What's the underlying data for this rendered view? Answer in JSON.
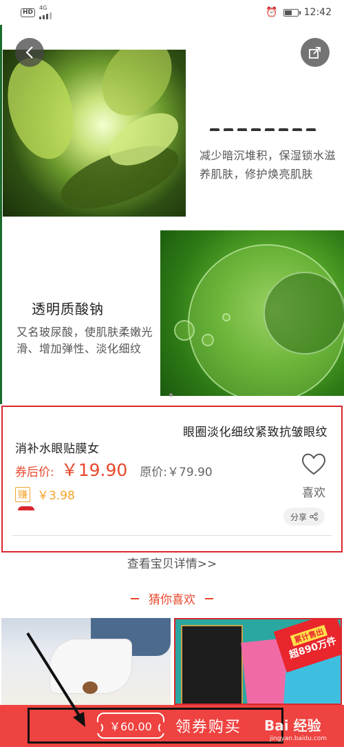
{
  "status_bar": {
    "hd_label": "HD",
    "network_type": "4G",
    "time": "12:42",
    "battery_level": 0.6
  },
  "product_images": {
    "right_description": "减少暗沉堆积，保湿锁水滋养肌肤，修护焕亮肌肤",
    "feature_title": "透明质酸钠",
    "feature_description": "又名玻尿酸，使肌肤柔嫩光滑、增加弹性、淡化细纹",
    "carousel_total": 2,
    "carousel_active": 1
  },
  "product": {
    "title_line1": "眼圈淡化细纹紧致抗皱眼纹",
    "title_line2": "消补水眼贴膜女",
    "price_label": "券后价:",
    "price": "￥19.90",
    "original_price": "原价:￥79.90",
    "earn_badge": "赚",
    "earn_amount": "￥3.98",
    "like_label": "喜欢",
    "share_label": "分享"
  },
  "view_details": "查看宝贝详情>>",
  "guess_you_like": "猜你喜欢",
  "recommendations": {
    "right_badge_top": "累计售出",
    "right_badge_main": "超890万件"
  },
  "bottom_bar": {
    "coupon_value": "￥60.00",
    "claim_label": "领券购买"
  },
  "watermark": {
    "text": "Bai 经验",
    "url": "jingyan.baidu.com"
  },
  "colors": {
    "accent_red": "#e8472c",
    "bottom_bar": "#ee4340",
    "highlight_box": "#d9262c",
    "earn_orange": "#f2a32a"
  }
}
